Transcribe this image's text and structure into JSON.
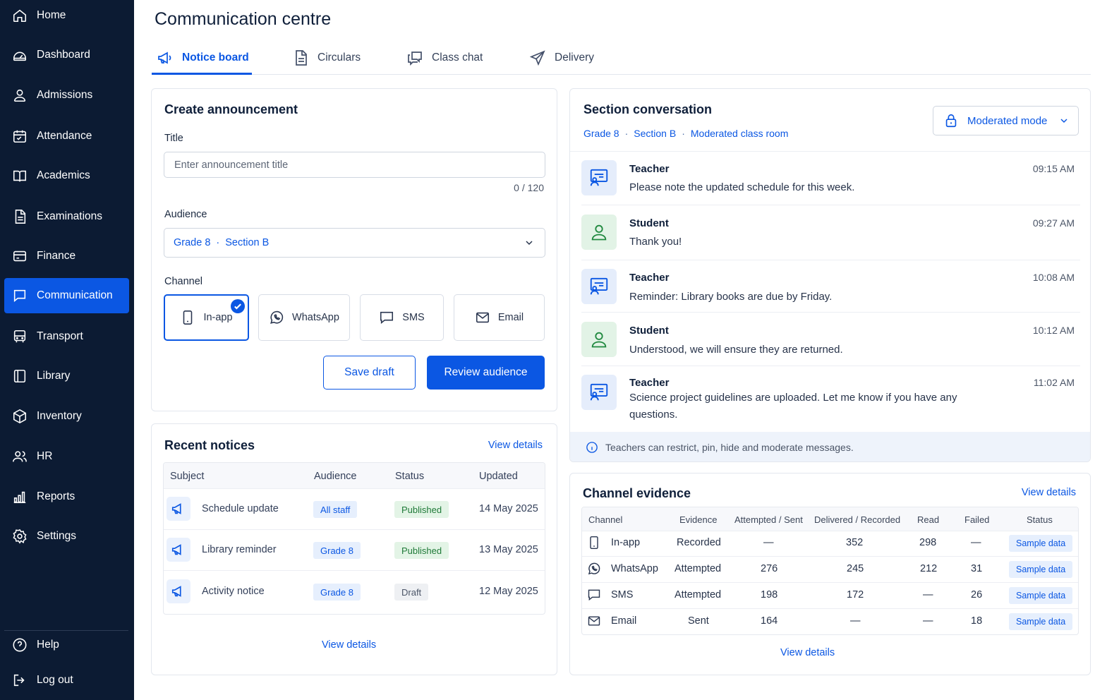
{
  "sidebar": {
    "items": [
      {
        "label": "Home",
        "icon": "home-icon"
      },
      {
        "label": "Dashboard",
        "icon": "dashboard-icon"
      },
      {
        "label": "Admissions",
        "icon": "user-icon"
      },
      {
        "label": "Attendance",
        "icon": "calendar-icon"
      },
      {
        "label": "Academics",
        "icon": "book-icon"
      },
      {
        "label": "Examinations",
        "icon": "document-icon"
      },
      {
        "label": "Finance",
        "icon": "card-icon"
      },
      {
        "label": "Communication",
        "icon": "chat-icon",
        "active": true
      },
      {
        "label": "Transport",
        "icon": "bus-icon"
      },
      {
        "label": "Library",
        "icon": "library-icon"
      },
      {
        "label": "Inventory",
        "icon": "box-icon"
      },
      {
        "label": "HR",
        "icon": "users-icon"
      },
      {
        "label": "Reports",
        "icon": "chart-icon"
      },
      {
        "label": "Settings",
        "icon": "gear-icon"
      }
    ],
    "help": "Help",
    "logout": "Log out"
  },
  "page": {
    "title": "Communication centre",
    "tabs": [
      {
        "label": "Notice board",
        "icon": "megaphone-icon",
        "active": true
      },
      {
        "label": "Circulars",
        "icon": "document-icon"
      },
      {
        "label": "Class chat",
        "icon": "chat-bubbles-icon"
      },
      {
        "label": "Delivery",
        "icon": "send-icon"
      }
    ]
  },
  "create": {
    "title": "Create announcement",
    "title_label": "Title",
    "title_placeholder": "Enter announcement title",
    "counter": "0 / 120",
    "audience_label": "Audience",
    "audience_grade": "Grade 8",
    "audience_sep": "·",
    "audience_section": "Section B",
    "channel_label": "Channel",
    "channels": [
      "In-app",
      "WhatsApp",
      "SMS",
      "Email"
    ],
    "save_draft": "Save draft",
    "review": "Review audience"
  },
  "recent": {
    "title": "Recent notices",
    "view_details": "View details",
    "headers": [
      "Subject",
      "Audience",
      "Status",
      "Updated"
    ],
    "rows": [
      {
        "subject": "Schedule update",
        "audience": "All staff",
        "status": "Published",
        "updated": "14 May 2025"
      },
      {
        "subject": "Library reminder",
        "audience": "Grade 8",
        "status": "Published",
        "updated": "13 May 2025"
      },
      {
        "subject": "Activity notice",
        "audience": "Grade 8",
        "status": "Draft",
        "updated": "12 May 2025"
      }
    ],
    "footer_link": "View details"
  },
  "conversation": {
    "title": "Section conversation",
    "crumbs": [
      "Grade 8",
      "Section B",
      "Moderated class room"
    ],
    "crumb_sep": "·",
    "mode": "Moderated mode",
    "messages": [
      {
        "role": "Teacher",
        "text": "Please note the updated schedule for this week.",
        "time": "09:15 AM"
      },
      {
        "role": "Student",
        "text": "Thank you!",
        "time": "09:27 AM"
      },
      {
        "role": "Teacher",
        "text": "Reminder: Library books are due by Friday.",
        "time": "10:08 AM"
      },
      {
        "role": "Student",
        "text": "Understood, we will ensure they are returned.",
        "time": "10:12 AM"
      },
      {
        "role": "Teacher",
        "text": "Science project guidelines are uploaded. Let me know if you have any questions.",
        "time": "11:02 AM"
      }
    ],
    "info": "Teachers can restrict, pin, hide and moderate messages."
  },
  "evidence": {
    "title": "Channel evidence",
    "view_details": "View details",
    "headers": [
      "Channel",
      "Evidence",
      "Attempted / Sent",
      "Delivered / Recorded",
      "Read",
      "Failed",
      "Status"
    ],
    "rows": [
      {
        "channel": "In-app",
        "evidence": "Recorded",
        "attempted": "—",
        "delivered": "352",
        "read": "298",
        "failed": "—",
        "status": "Sample data"
      },
      {
        "channel": "WhatsApp",
        "evidence": "Attempted",
        "attempted": "276",
        "delivered": "245",
        "read": "212",
        "failed": "31",
        "status": "Sample data"
      },
      {
        "channel": "SMS",
        "evidence": "Attempted",
        "attempted": "198",
        "delivered": "172",
        "read": "—",
        "failed": "26",
        "status": "Sample data"
      },
      {
        "channel": "Email",
        "evidence": "Sent",
        "attempted": "164",
        "delivered": "—",
        "read": "—",
        "failed": "18",
        "status": "Sample data"
      }
    ],
    "footer_link": "View details"
  },
  "colors": {
    "accent": "#0b57e3",
    "sidebar": "#0c1b33",
    "success": "#1f7a38"
  }
}
